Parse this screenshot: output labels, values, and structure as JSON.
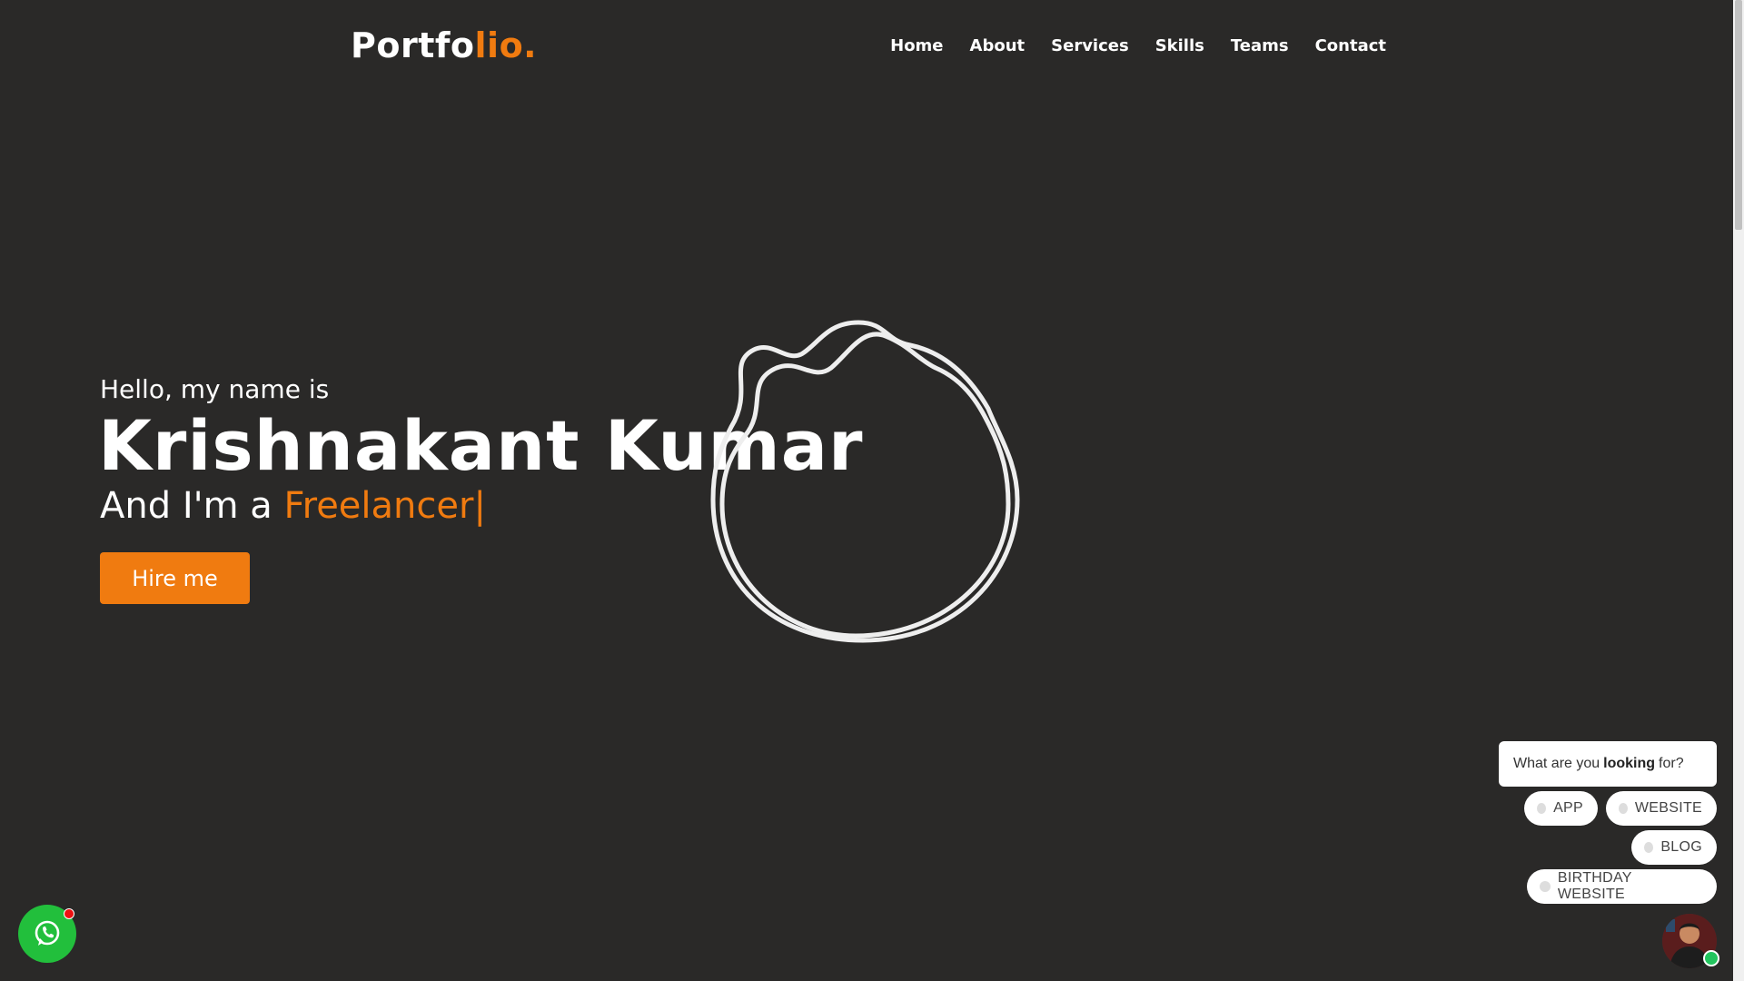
{
  "header": {
    "logo_main": "Portfo",
    "logo_accent": "lio."
  },
  "nav": {
    "items": [
      {
        "label": "Home"
      },
      {
        "label": "About"
      },
      {
        "label": "Services"
      },
      {
        "label": "Skills"
      },
      {
        "label": "Teams"
      },
      {
        "label": "Contact"
      }
    ]
  },
  "hero": {
    "greeting": "Hello, my name is",
    "name": "Krishnakant Kumar",
    "role_prefix": "And I'm a ",
    "role_typed": "Freelancer",
    "cursor": "|",
    "cta_label": "Hire me"
  },
  "colors": {
    "background": "#2a2928",
    "accent": "#f07b10",
    "whatsapp": "#22bf3c",
    "online": "#22c55e"
  },
  "chat": {
    "question_before": "What are you",
    "question_bold": "looking",
    "question_after": "for?",
    "options": [
      {
        "label": "APP"
      },
      {
        "label": "WEBSITE"
      },
      {
        "label": "BLOG"
      },
      {
        "label": "BIRTHDAY WEBSITE"
      }
    ]
  },
  "icons": {
    "whatsapp": "whatsapp-icon",
    "avatar": "avatar",
    "decoration": "wavy-circle"
  }
}
